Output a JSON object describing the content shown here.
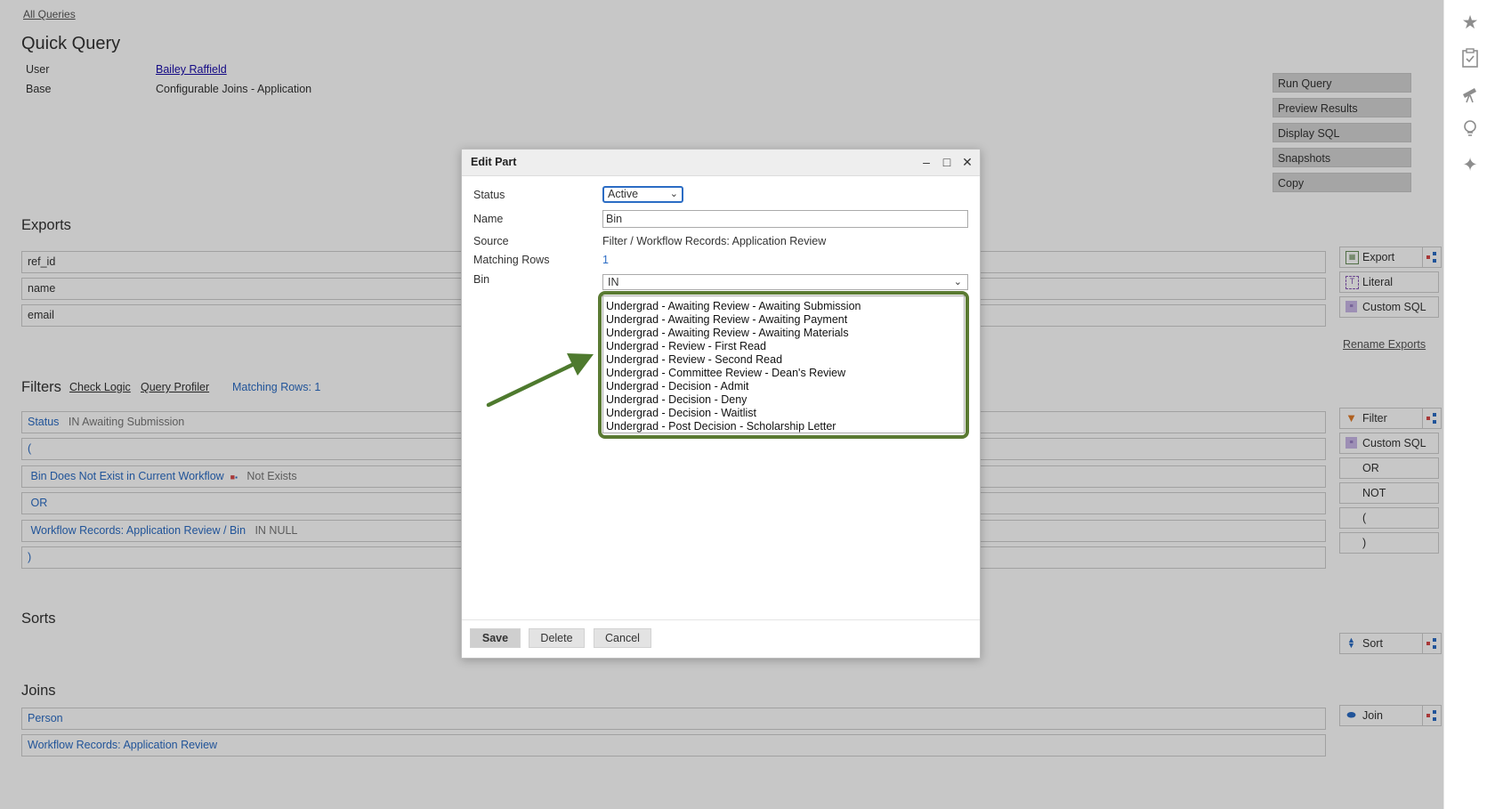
{
  "breadcrumb": "All Queries",
  "title": "Quick Query",
  "meta": {
    "user_label": "User",
    "user_value": "Bailey Raffield",
    "base_label": "Base",
    "base_value": "Configurable Joins - Application"
  },
  "actions": [
    "Run Query",
    "Preview Results",
    "Display SQL",
    "Snapshots",
    "Copy"
  ],
  "exports": {
    "title": "Exports",
    "rows": [
      "ref_id",
      "name",
      "email"
    ],
    "tools": [
      "Export",
      "Literal",
      "Custom SQL"
    ],
    "rename_link": "Rename Exports"
  },
  "filters": {
    "title": "Filters",
    "check_logic": "Check Logic",
    "query_profiler": "Query Profiler",
    "matching_rows": "Matching Rows: 1",
    "rows": [
      {
        "name": "Status",
        "detail": "IN Awaiting Submission"
      },
      {
        "name": "(",
        "detail": ""
      },
      {
        "name": "Bin Does Not Exist in Current Workflow",
        "detail": "Not Exists"
      },
      {
        "name": "OR",
        "detail": ""
      },
      {
        "name": "Workflow Records: Application Review / Bin",
        "detail": "IN NULL"
      },
      {
        "name": ")",
        "detail": ""
      }
    ],
    "tools": [
      "Filter",
      "Custom SQL",
      "OR",
      "NOT",
      "(",
      ")"
    ]
  },
  "sorts": {
    "title": "Sorts",
    "tool": "Sort"
  },
  "joins": {
    "title": "Joins",
    "rows": [
      "Person",
      "Workflow Records: Application Review"
    ],
    "tool": "Join"
  },
  "dialog": {
    "title": "Edit Part",
    "status_label": "Status",
    "status_value": "Active",
    "name_label": "Name",
    "name_value": "Bin",
    "source_label": "Source",
    "source_value": "Filter / Workflow Records: Application Review",
    "matching_label": "Matching Rows",
    "matching_value": "1",
    "bin_label": "Bin",
    "bin_operator": "IN",
    "bin_options": [
      "Undergrad - Awaiting Review - Awaiting Submission",
      "Undergrad - Awaiting Review - Awaiting Payment",
      "Undergrad - Awaiting Review - Awaiting Materials",
      "Undergrad - Review - First Read",
      "Undergrad - Review - Second Read",
      "Undergrad - Committee Review - Dean's Review",
      "Undergrad - Decision - Admit",
      "Undergrad - Decision - Deny",
      "Undergrad - Decision - Waitlist",
      "Undergrad - Post Decision - Scholarship Letter"
    ],
    "save": "Save",
    "delete": "Delete",
    "cancel": "Cancel"
  },
  "colors": {
    "accent": "#2b6cc4",
    "highlight": "#5a7a32"
  },
  "icons": [
    "star-icon",
    "checklist-icon",
    "telescope-icon",
    "lightbulb-icon",
    "sparkle-icon"
  ]
}
